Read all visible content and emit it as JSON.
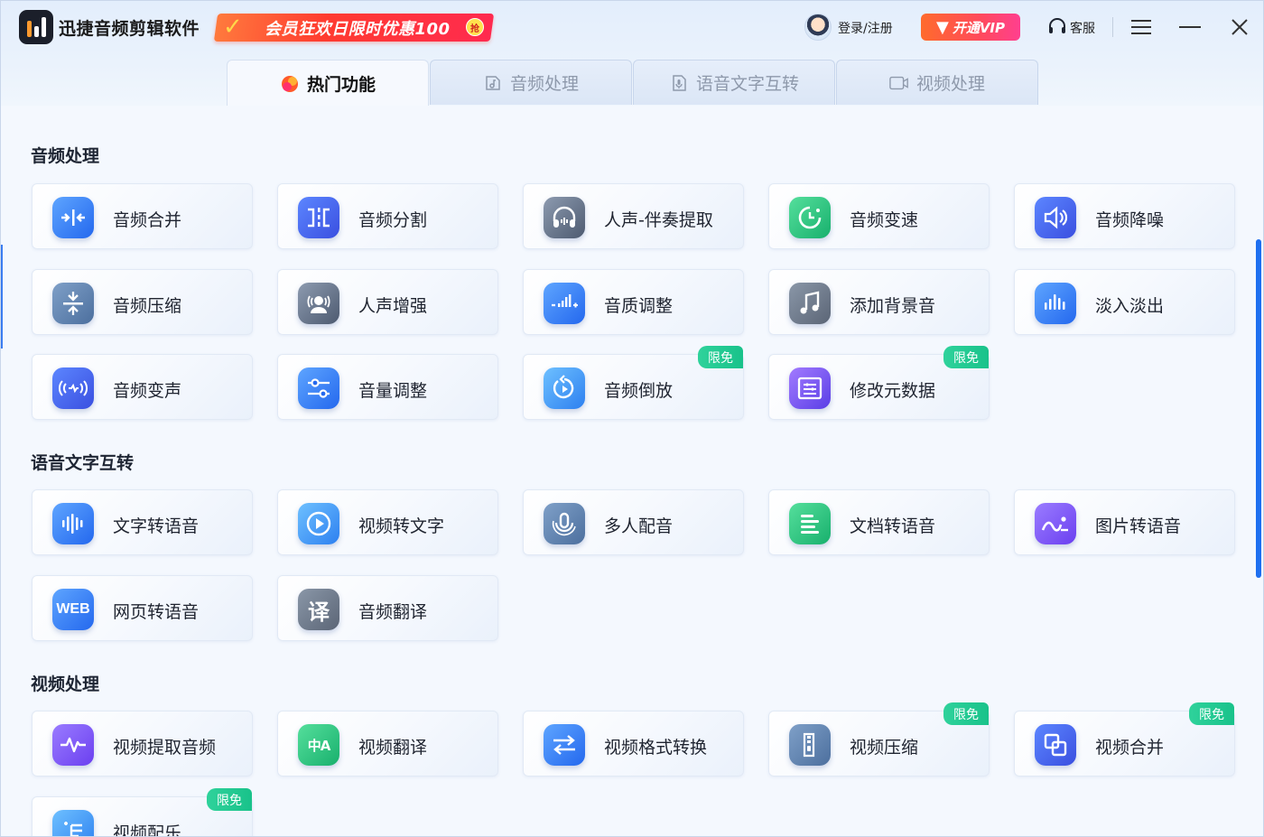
{
  "app": {
    "title": "迅捷音频剪辑软件",
    "promo_text": "会员狂欢日限时优惠100",
    "promo_badge": "抢",
    "login_label": "登录/注册",
    "vip_label": "开通VIP",
    "service_label": "客服"
  },
  "tabs": [
    {
      "label": "热门功能",
      "icon": "fire-icon",
      "active": true
    },
    {
      "label": "音频处理",
      "icon": "music-file-icon",
      "active": false
    },
    {
      "label": "语音文字互转",
      "icon": "mic-file-icon",
      "active": false
    },
    {
      "label": "视频处理",
      "icon": "video-camera-icon",
      "active": false
    }
  ],
  "sections": [
    {
      "title": "音频处理",
      "items": [
        {
          "label": "音频合并",
          "icon": "merge-icon"
        },
        {
          "label": "音频分割",
          "icon": "split-icon"
        },
        {
          "label": "人声-伴奏提取",
          "icon": "headphone-icon"
        },
        {
          "label": "音频变速",
          "icon": "speed-icon"
        },
        {
          "label": "音频降噪",
          "icon": "speaker-icon"
        },
        {
          "label": "音频压缩",
          "icon": "compress-icon"
        },
        {
          "label": "人声增强",
          "icon": "voice-enhance-icon"
        },
        {
          "label": "音质调整",
          "icon": "quality-icon"
        },
        {
          "label": "添加背景音",
          "icon": "music-note-icon"
        },
        {
          "label": "淡入淡出",
          "icon": "fade-icon"
        },
        {
          "label": "音频变声",
          "icon": "voice-change-icon"
        },
        {
          "label": "音量调整",
          "icon": "volume-slider-icon"
        },
        {
          "label": "音频倒放",
          "icon": "reverse-icon",
          "badge": "限免"
        },
        {
          "label": "修改元数据",
          "icon": "metadata-icon",
          "badge": "限免"
        }
      ]
    },
    {
      "title": "语音文字互转",
      "items": [
        {
          "label": "文字转语音",
          "icon": "waveform-icon"
        },
        {
          "label": "视频转文字",
          "icon": "play-icon"
        },
        {
          "label": "多人配音",
          "icon": "multi-voice-icon"
        },
        {
          "label": "文档转语音",
          "icon": "document-icon"
        },
        {
          "label": "图片转语音",
          "icon": "image-icon"
        },
        {
          "label": "网页转语音",
          "icon": "web-icon",
          "icon_text": "WEB"
        },
        {
          "label": "音频翻译",
          "icon": "translate-icon",
          "icon_text": "译"
        }
      ]
    },
    {
      "title": "视频处理",
      "items": [
        {
          "label": "视频提取音频",
          "icon": "pulse-icon"
        },
        {
          "label": "视频翻译",
          "icon": "zh-a-icon",
          "icon_text": "中A"
        },
        {
          "label": "视频格式转换",
          "icon": "convert-icon"
        },
        {
          "label": "视频压缩",
          "icon": "zip-icon",
          "badge": "限免"
        },
        {
          "label": "视频合并",
          "icon": "overlap-icon",
          "badge": "限免"
        },
        {
          "label": "视频配乐",
          "icon": "video-music-icon",
          "badge": "限免"
        }
      ]
    }
  ],
  "colors": {
    "accent": "#1e6ff0",
    "badge": "#1fc68e",
    "vip": "#ff4a5c"
  }
}
